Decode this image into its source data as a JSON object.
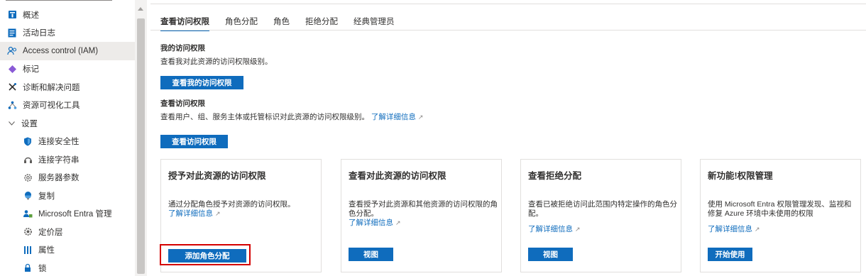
{
  "sidebar": {
    "items": [
      {
        "label": "概述",
        "icon": "overview-icon",
        "color": "#0f6cbd"
      },
      {
        "label": "活动日志",
        "icon": "activity-log-icon",
        "color": "#0f6cbd"
      },
      {
        "label": "Access control (IAM)",
        "icon": "iam-icon",
        "color": "#0f6cbd"
      },
      {
        "label": "标记",
        "icon": "tag-icon",
        "color": "#8a5ad6"
      },
      {
        "label": "诊断和解决问题",
        "icon": "diagnose-icon",
        "color": "#323130"
      },
      {
        "label": "资源可视化工具",
        "icon": "visualizer-icon",
        "color": "#0f6cbd"
      },
      {
        "label": "设置",
        "icon": "chevron-down-icon",
        "color": "#605e5c"
      },
      {
        "label": "连接安全性",
        "icon": "shield-icon",
        "color": "#0f6cbd"
      },
      {
        "label": "连接字符串",
        "icon": "connection-string-icon",
        "color": "#605e5c"
      },
      {
        "label": "服务器参数",
        "icon": "gear-icon",
        "color": "#605e5c"
      },
      {
        "label": "复制",
        "icon": "replication-icon",
        "color": "#0f6cbd"
      },
      {
        "label": "Microsoft Entra 管理",
        "icon": "entra-icon",
        "color": "#0f6cbd"
      },
      {
        "label": "定价层",
        "icon": "pricing-icon",
        "color": "#605e5c"
      },
      {
        "label": "属性",
        "icon": "properties-icon",
        "color": "#0f6cbd"
      },
      {
        "label": "锁",
        "icon": "lock-icon",
        "color": "#0f6cbd"
      }
    ]
  },
  "tabs": [
    "查看访问权限",
    "角色分配",
    "角色",
    "拒绝分配",
    "经典管理员"
  ],
  "my_access": {
    "title": "我的访问权限",
    "desc": "查看我对此资源的访问权限级别。",
    "button": "查看我的访问权限"
  },
  "check_access": {
    "title": "查看访问权限",
    "desc": "查看用户、组、服务主体或托管标识对此资源的访问权限级别。",
    "link": "了解详细信息",
    "button": "查看访问权限"
  },
  "cards": [
    {
      "title": "授予对此资源的访问权限",
      "desc": "通过分配角色授予对资源的访问权限。",
      "link": "了解详细信息",
      "button": "添加角色分配"
    },
    {
      "title": "查看对此资源的访问权限",
      "desc": "查看授予对此资源和其他资源的访问权限的角色分配。",
      "link": "了解详细信息",
      "button": "视图"
    },
    {
      "title": "查看拒绝分配",
      "desc": "查看已被拒绝访问此范围内特定操作的角色分配。",
      "link": "了解详细信息",
      "button": "视图"
    },
    {
      "title": "新功能!权限管理",
      "desc": "使用 Microsoft Entra 权限管理发现、监视和修复 Azure 环境中未使用的权限",
      "link": "了解详细信息",
      "button": "开始使用"
    }
  ],
  "colors": {
    "accent": "#0f6cbd",
    "highlight": "#d40000"
  }
}
